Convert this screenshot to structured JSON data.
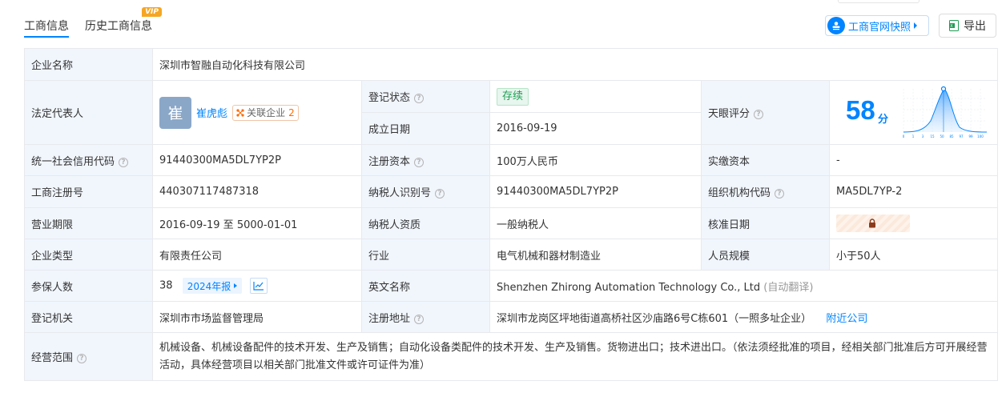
{
  "tabs": [
    {
      "label": "工商信息",
      "active": true
    },
    {
      "label": "历史工商信息",
      "badge": "VIP"
    }
  ],
  "actions": {
    "snapshot_label": "工商官网快照",
    "export_label": "导出"
  },
  "company": {
    "name_label": "企业名称",
    "name": "深圳市智融自动化科技有限公司",
    "rep_label": "法定代表人",
    "rep_avatar": "崔",
    "rep_name": "崔虎彪",
    "rep_related_label": "关联企业",
    "rep_related_count": "2",
    "status_label": "登记状态",
    "status": "存续",
    "founded_label": "成立日期",
    "founded": "2016-09-19",
    "score_label": "天眼评分",
    "score": "58",
    "score_unit": "分",
    "score_axis": [
      "0",
      "1",
      "3",
      "15",
      "50",
      "85",
      "97",
      "99",
      "100"
    ],
    "credit_code_label": "统一社会信用代码",
    "credit_code": "91440300MA5DL7YP2P",
    "reg_capital_label": "注册资本",
    "reg_capital": "100万人民币",
    "paid_capital_label": "实缴资本",
    "paid_capital": "-",
    "reg_no_label": "工商注册号",
    "reg_no": "440307117487318",
    "tax_id_label": "纳税人识别号",
    "tax_id": "91440300MA5DL7YP2P",
    "org_code_label": "组织机构代码",
    "org_code": "MA5DL7YP-2",
    "term_label": "营业期限",
    "term": "2016-09-19 至 5000-01-01",
    "taxpayer_type_label": "纳税人资质",
    "taxpayer_type": "一般纳税人",
    "approval_date_label": "核准日期",
    "type_label": "企业类型",
    "type": "有限责任公司",
    "industry_label": "行业",
    "industry": "电气机械和器材制造业",
    "staff_size_label": "人员规模",
    "staff_size": "小于50人",
    "insured_label": "参保人数",
    "insured": "38",
    "insured_year": "2024年报",
    "english_name_label": "英文名称",
    "english_name": "Shenzhen Zhirong Automation Technology Co., Ltd",
    "english_name_note": "(自动翻译)",
    "authority_label": "登记机关",
    "authority": "深圳市市场监督管理局",
    "address_label": "注册地址",
    "address": "深圳市龙岗区坪地街道高桥社区沙庙路6号C栋601（一照多址企业）",
    "nearby_label": "附近公司",
    "scope_label": "经营范围",
    "scope": "机械设备、机械设备配件的技术开发、生产及销售；自动化设备类配件的技术开发、生产及销售。货物进出口；技术进出口。（依法须经批准的项目，经相关部门批准后方可开展经营活动，具体经营项目以相关部门批准文件或许可证件为准）"
  },
  "colors": {
    "accent": "#0084ff",
    "label_bg": "#f1f6fd",
    "status_green": "#1f9d55"
  }
}
